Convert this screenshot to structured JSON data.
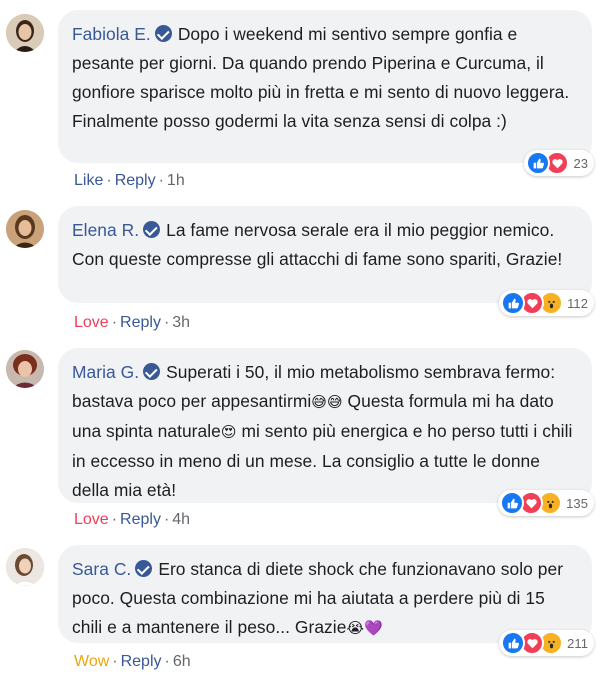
{
  "comments": [
    {
      "author": "Fabiola E.",
      "text": "Dopo i weekend mi sentivo sempre gonfia e pesante per giorni. Da quando prendo Piperina e Curcuma, il gonfiore sparisce molto più in fretta e mi sento di nuovo leggera. Finalmente posso godermi la vita senza sensi di colpa :)",
      "reactions": [
        "like",
        "love"
      ],
      "reaction_count": "23",
      "action_label": "Like",
      "reply_label": "Reply",
      "time": "1h"
    },
    {
      "author": "Elena R.",
      "text": "La fame nervosa serale era il mio peggior nemico. Con queste compresse gli attacchi di fame sono spariti, Grazie!",
      "reactions": [
        "like",
        "love",
        "wow"
      ],
      "reaction_count": "112",
      "action_label": "Love",
      "reply_label": "Reply",
      "time": "3h"
    },
    {
      "author": "Maria G.",
      "text_parts": [
        "Superati i 50, il mio metabolismo sembrava fermo: bastava poco per appesantirmi",
        "😅😅",
        " Questa formula mi ha dato una spinta naturale",
        "😍",
        " mi sento più energica e ho perso tutti i chili in eccesso in meno di un mese. La consiglio a tutte le donne della mia età!"
      ],
      "reactions": [
        "like",
        "love",
        "wow"
      ],
      "reaction_count": "135",
      "action_label": "Love",
      "reply_label": "Reply",
      "time": "4h"
    },
    {
      "author": "Sara C.",
      "text_parts": [
        "Ero stanca di diete shock che funzionavano solo per poco. Questa combinazione mi ha aiutata a perdere più di 15 chili e a mantenere il peso... Grazie",
        "😭💜"
      ],
      "reactions": [
        "like",
        "love",
        "wow"
      ],
      "reaction_count": "211",
      "action_label": "Wow",
      "reply_label": "Reply",
      "time": "6h"
    }
  ],
  "separator": "·",
  "colors": {
    "author": "#385898",
    "bubble": "#f1f2f4",
    "like": "#1877f2",
    "love": "#f33e58",
    "wow": "#f7b125",
    "meta": "#65676b"
  }
}
